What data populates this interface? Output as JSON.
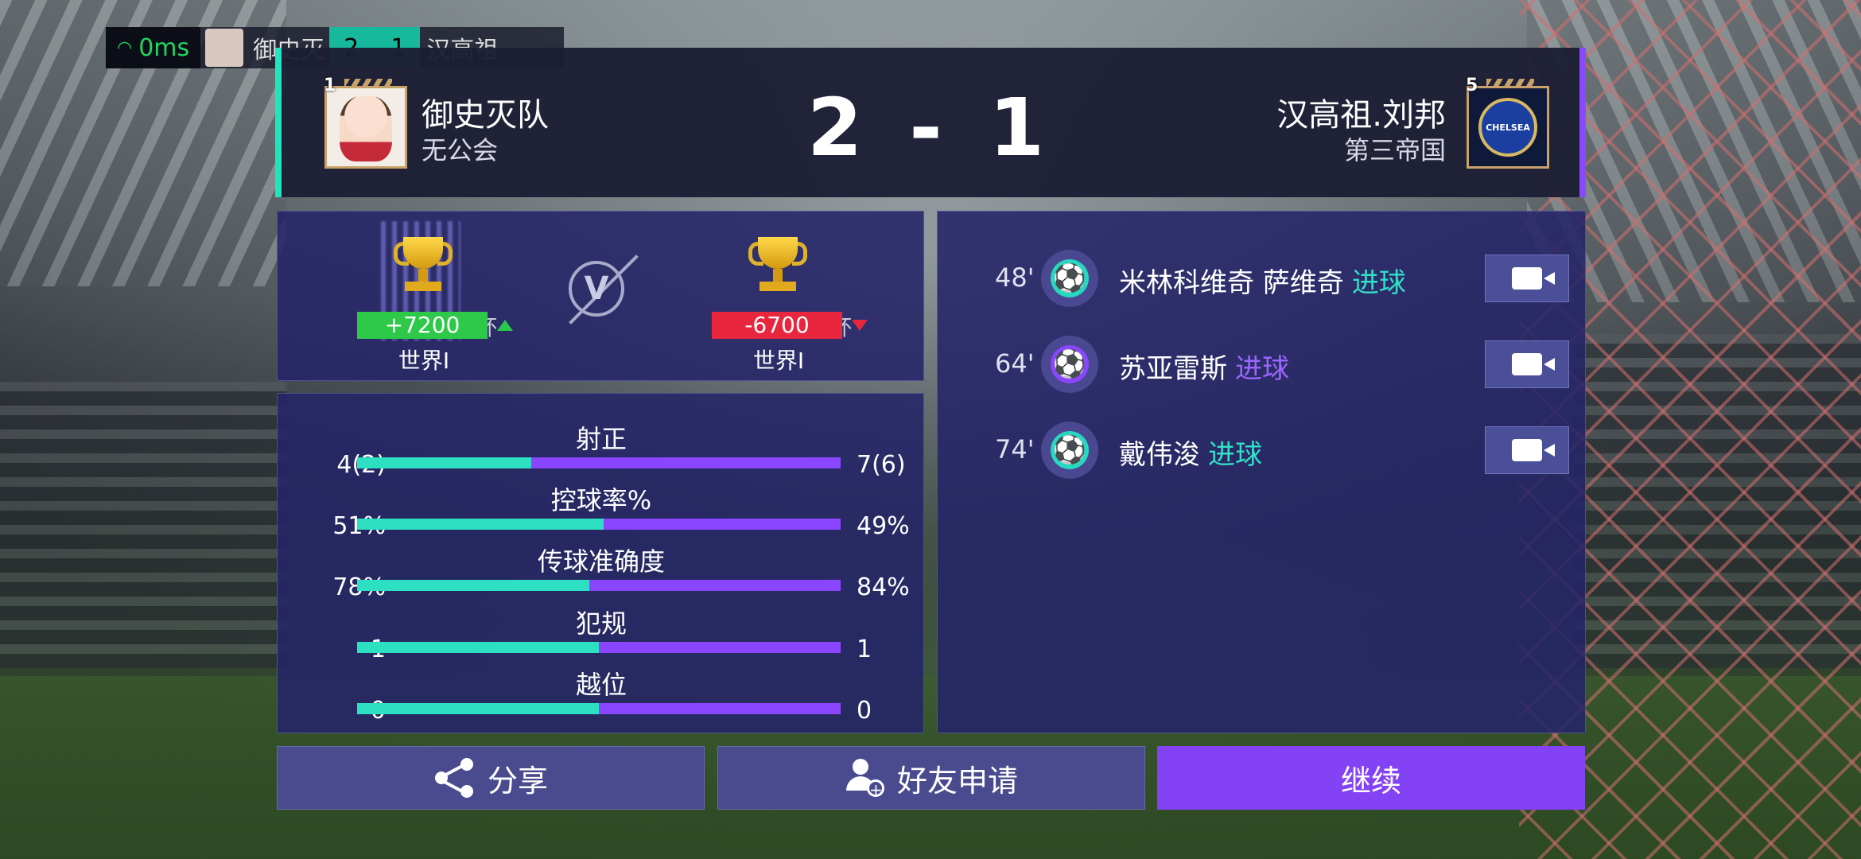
{
  "mini_bar": {
    "ping": "0ms",
    "home_name": "御史灭",
    "home_score": "2",
    "away_score": "1",
    "away_name": "汉高祖"
  },
  "match": {
    "home": {
      "rank": "1",
      "name": "御史灭队",
      "guild": "无公会"
    },
    "away": {
      "rank": "5",
      "name": "汉高祖.刘邦",
      "guild": "第三帝国",
      "crest_text": "CHELSEA"
    },
    "score": "2 - 1"
  },
  "reward": {
    "home": {
      "delta": "+7200",
      "league": "世界I",
      "ghost_text": "杯"
    },
    "away": {
      "delta": "-6700",
      "league": "世界I",
      "ghost_text": "杯"
    },
    "vs": "V"
  },
  "stats": [
    {
      "label": "射正",
      "home": "4(2)",
      "away": "7(6)",
      "home_share": 0.36
    },
    {
      "label": "控球率%",
      "home": "51%",
      "away": "49%",
      "home_share": 0.51
    },
    {
      "label": "传球准确度",
      "home": "78%",
      "away": "84%",
      "home_share": 0.48
    },
    {
      "label": "犯规",
      "home": "1",
      "away": "1",
      "home_share": 0.5
    },
    {
      "label": "越位",
      "home": "0",
      "away": "0",
      "home_share": 0.5
    }
  ],
  "events": [
    {
      "minute": "48'",
      "player": "米林科维奇 萨维奇",
      "type": "进球",
      "side": "home",
      "icon": "soccer-ball-icon"
    },
    {
      "minute": "64'",
      "player": "苏亚雷斯",
      "type": "进球",
      "side": "away",
      "icon": "soccer-ball-icon"
    },
    {
      "minute": "74'",
      "player": "戴伟浚",
      "type": "进球",
      "side": "home",
      "icon": "soccer-ball-icon"
    }
  ],
  "buttons": {
    "share": "分享",
    "friend_request": "好友申请",
    "continue": "继续"
  },
  "colors": {
    "home_accent": "#23e3be",
    "away_accent": "#8b49ff",
    "continue_button": "#8442f5",
    "gain": "#2fc94a",
    "loss": "#e8263e"
  }
}
